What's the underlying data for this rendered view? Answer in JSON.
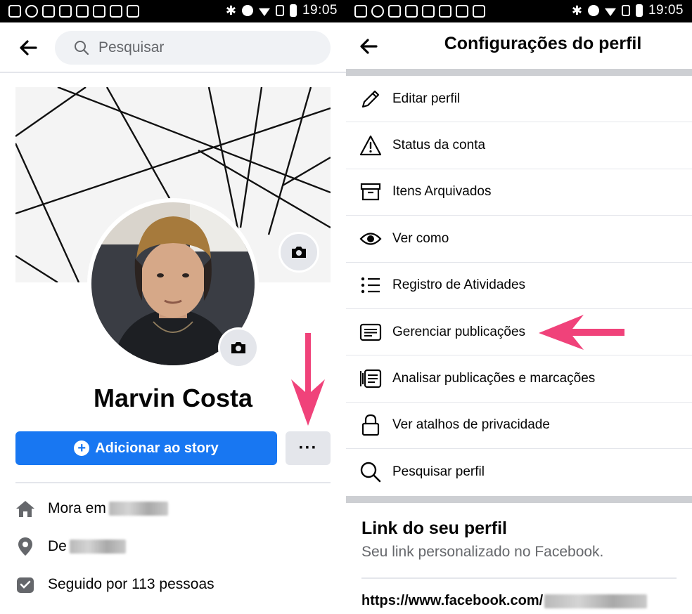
{
  "status_bar": {
    "time": "19:05",
    "icons": [
      "chat-icon",
      "whatsapp-icon",
      "gmail-icon",
      "instagram-icon",
      "gallery-icon",
      "instagram-icon",
      "instagram-icon",
      "news-icon"
    ],
    "right_icons": [
      "bluetooth-icon",
      "dnd-icon",
      "wifi-icon",
      "no-sim-icon",
      "battery-icon"
    ]
  },
  "left": {
    "search": {
      "placeholder": "Pesquisar"
    },
    "profile": {
      "name": "Marvin Costa"
    },
    "actions": {
      "add_story": "Adicionar ao story",
      "more": "···"
    },
    "info": {
      "lives_in": "Mora em",
      "from": "De",
      "followers": "Seguido por 113 pessoas"
    }
  },
  "right": {
    "title": "Configurações do perfil",
    "menu": [
      {
        "label": "Editar perfil",
        "icon": "pencil-icon"
      },
      {
        "label": "Status da conta",
        "icon": "warning-icon"
      },
      {
        "label": "Itens Arquivados",
        "icon": "archive-icon"
      },
      {
        "label": "Ver como",
        "icon": "eye-icon"
      },
      {
        "label": "Registro de Atividades",
        "icon": "list-icon"
      },
      {
        "label": "Gerenciar publicações",
        "icon": "manage-posts-icon"
      },
      {
        "label": "Analisar publicações e marcações",
        "icon": "review-posts-icon"
      },
      {
        "label": "Ver atalhos de privacidade",
        "icon": "lock-icon"
      },
      {
        "label": "Pesquisar perfil",
        "icon": "search-icon"
      }
    ],
    "link_section": {
      "title": "Link do seu perfil",
      "subtitle": "Seu link personalizado no Facebook.",
      "url": "https://www.facebook.com/"
    }
  },
  "colors": {
    "primary": "#1877f2",
    "annotation_arrow": "#f0427a",
    "secondary_text": "#65676b",
    "button_gray": "#e4e6eb"
  }
}
